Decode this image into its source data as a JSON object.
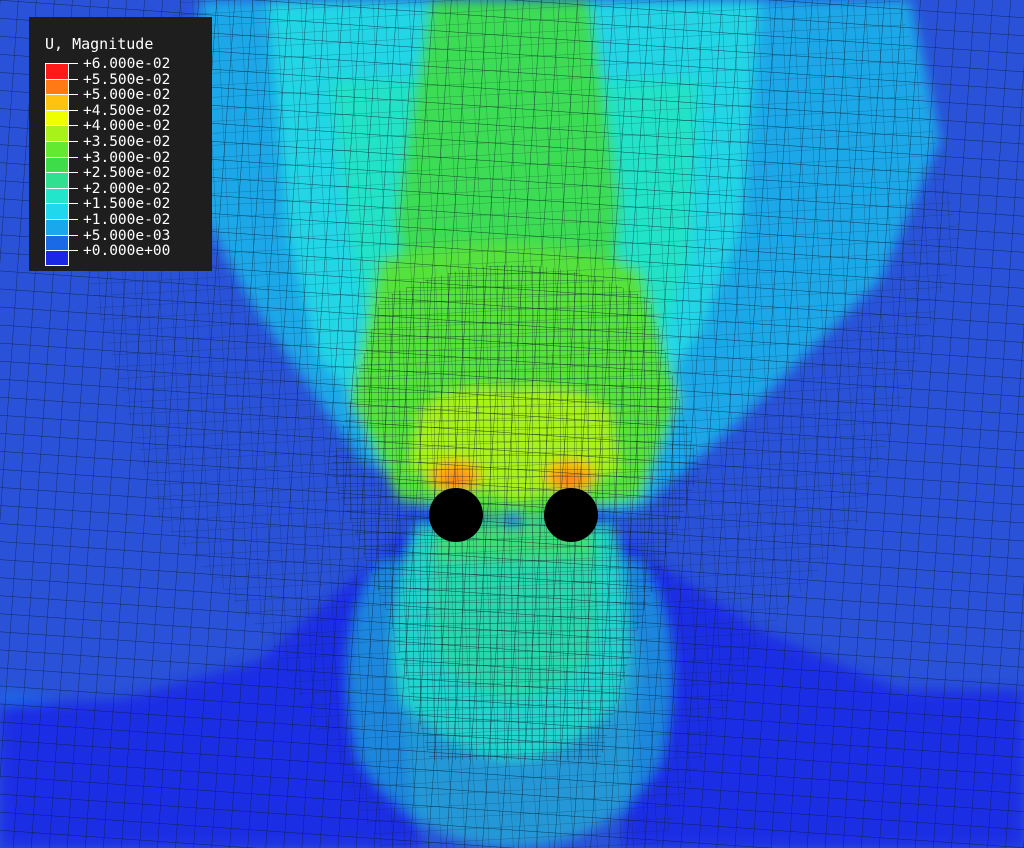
{
  "legend": {
    "title": "U, Magnitude",
    "labels": [
      "+6.000e-02",
      "+5.500e-02",
      "+5.000e-02",
      "+4.500e-02",
      "+4.000e-02",
      "+3.500e-02",
      "+3.000e-02",
      "+2.500e-02",
      "+2.000e-02",
      "+1.500e-02",
      "+1.000e-02",
      "+5.000e-03",
      "+0.000e+00"
    ],
    "colors": [
      "#ff1a1a",
      "#ff7a14",
      "#ffc20e",
      "#f0ff00",
      "#a8f21a",
      "#64e830",
      "#3fdc4a",
      "#2ee08f",
      "#22e6cc",
      "#20d8ee",
      "#1aa8ec",
      "#1a6ae8",
      "#1a28e6"
    ]
  },
  "mesh": {
    "background_color": "#2a52d8",
    "mesh_line_color": "#0b1b2a",
    "hole_color": "#000000",
    "hole_count": 2
  }
}
